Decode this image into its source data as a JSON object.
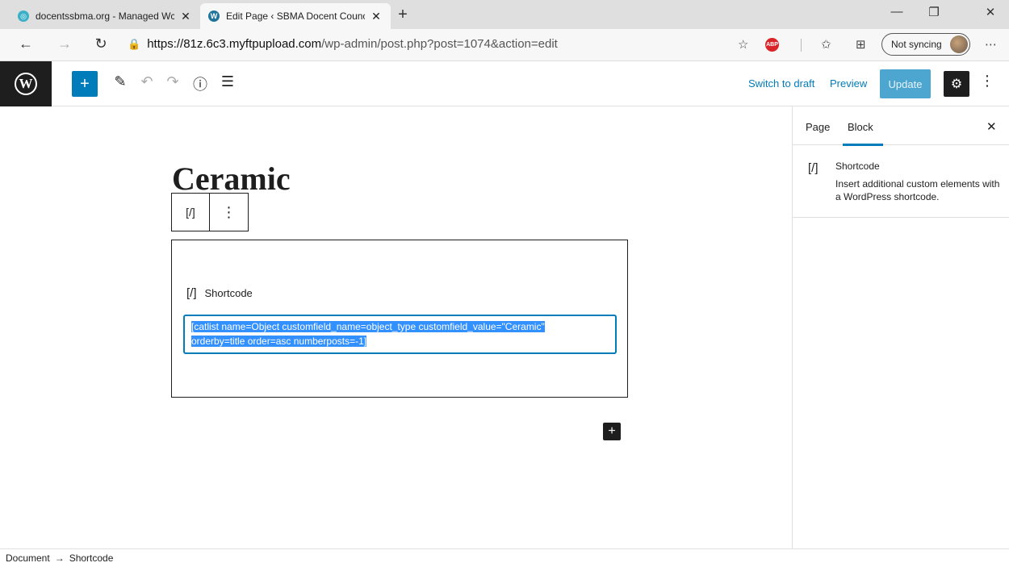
{
  "browser": {
    "tabs": [
      {
        "title": "docentssbma.org - Managed Wc",
        "close": "✕",
        "favicon": "domain-favicon",
        "active": false
      },
      {
        "title": "Edit Page ‹ SBMA Docent Counc",
        "close": "✕",
        "favicon": "wordpress-favicon",
        "active": true
      }
    ],
    "new_tab": "+",
    "window_controls": {
      "minimize": "—",
      "restore": "❐",
      "close": "✕"
    },
    "nav": {
      "back": "←",
      "forward": "→",
      "refresh": "↻"
    },
    "url": {
      "lock": "🔒",
      "host": "https://81z.6c3.myftpupload.com",
      "path": "/wp-admin/post.php?post=1074&action=edit"
    },
    "toolbar_icons": {
      "favorite": "☆",
      "abp": "ABP",
      "favorites_bar": "✩",
      "collections": "⊞",
      "more": "⋯"
    },
    "sync_label": "Not syncing"
  },
  "editor": {
    "header": {
      "add_block": "+",
      "tools": {
        "edit": "✎",
        "undo": "↶",
        "redo": "↷",
        "info": "ⓘ",
        "outline": "☰"
      },
      "switch_to_draft": "Switch to draft",
      "preview": "Preview",
      "update": "Update",
      "settings": "⚙",
      "more": "⋮"
    },
    "page_title": "Ceramic",
    "block_toolbar": {
      "type_icon": "[/]",
      "options": "⋮"
    },
    "shortcode_block": {
      "icon": "[/]",
      "label": "Shortcode",
      "value_line1": "[catlist name=Object customfield_name=object_type customfield_value=\"Ceramic\"",
      "value_line2": "orderby=title order=asc numberposts=-1]"
    },
    "inserter": "+"
  },
  "sidebar": {
    "tabs": [
      "Page",
      "Block"
    ],
    "active_tab": "Block",
    "close": "✕",
    "block": {
      "icon": "[/]",
      "name": "Shortcode",
      "description": "Insert additional custom elements with a WordPress shortcode."
    }
  },
  "footer": {
    "breadcrumb": [
      "Document",
      "Shortcode"
    ],
    "separator": "→"
  },
  "colors": {
    "accent": "#007cba",
    "dark": "#1e1e1e",
    "selection": "#3390ff"
  }
}
